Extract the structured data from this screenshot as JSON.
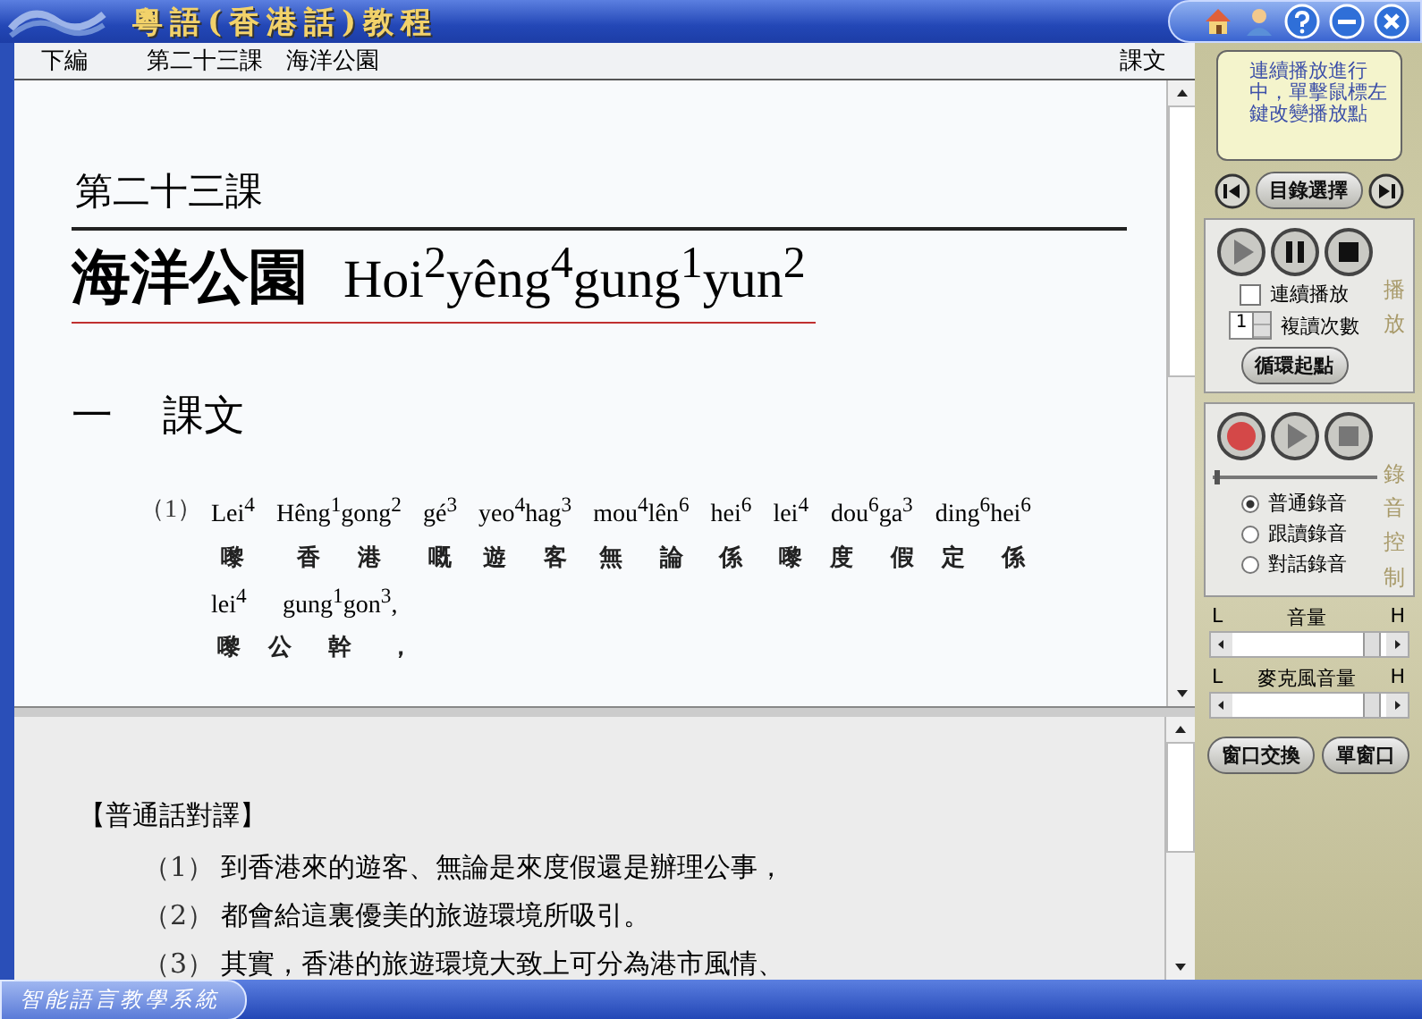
{
  "window": {
    "title": "粵語(香港話)教程"
  },
  "header": {
    "volume": "下編",
    "lesson": "第二十三課　海洋公園",
    "section": "課文"
  },
  "lesson": {
    "number": "第二十三課",
    "title": "海洋公園",
    "title_roman": "Hoi$^{2}$yêng$^{4}$gung$^{1}$yun$^{2}$",
    "heading_num": "一",
    "heading": "課文",
    "sentences": [
      {
        "num": "（1）",
        "lines": [
          [
            {
              "roman": "Lei$^{4}$",
              "hanzi": "嚟"
            },
            {
              "roman": "Hêng$^{1}$gong$^{2}$",
              "hanzi": "香港"
            },
            {
              "roman": "gé$^{3}$",
              "hanzi": "嘅"
            },
            {
              "roman": "yeo$^{4}$hag$^{3}$",
              "hanzi": "遊客"
            },
            {
              "roman": "mou$^{4}$lên$^{6}$",
              "hanzi": "無論"
            },
            {
              "roman": "hei$^{6}$",
              "hanzi": "係"
            },
            {
              "roman": "lei$^{4}$",
              "hanzi": "嚟"
            },
            {
              "roman": "dou$^{6}$ga$^{3}$",
              "hanzi": "度假"
            },
            {
              "roman": "ding$^{6}$hei$^{6}$",
              "hanzi": "定係"
            }
          ],
          [
            {
              "roman": "lei$^{4}$",
              "hanzi": "嚟"
            },
            {
              "roman": "gung$^{1}$gon$^{3}$,",
              "hanzi": "公幹，"
            }
          ]
        ]
      }
    ]
  },
  "translation": {
    "heading": "【普通話對譯】",
    "items": [
      {
        "num": "（1）",
        "text": "到香港來的遊客、無論是來度假還是辦理公事，"
      },
      {
        "num": "（2）",
        "text": "都會給這裏優美的旅遊環境所吸引。"
      },
      {
        "num": "（3）",
        "text": "其實，香港的旅遊環境大致上可分為港市風情、"
      }
    ]
  },
  "sidebar": {
    "tip": "連續播放進行中，單擊鼠標左鍵改變播放點",
    "menu_button": "目錄選擇",
    "playback": {
      "label": "播放",
      "continuous": {
        "label": "連續播放",
        "checked": false
      },
      "repeat": {
        "value": "1",
        "label": "複讀次數"
      },
      "loop_button": "循環起點"
    },
    "recording": {
      "label": "錄音控制",
      "level": 0.02,
      "modes": [
        {
          "label": "普通錄音",
          "selected": true
        },
        {
          "label": "跟讀錄音",
          "selected": false
        },
        {
          "label": "對話錄音",
          "selected": false
        }
      ]
    },
    "sliders": [
      {
        "low": "L",
        "label": "音量",
        "high": "H",
        "level": 0.95
      },
      {
        "low": "L",
        "label": "麥克風音量",
        "high": "H",
        "level": 0.95
      }
    ],
    "buttons": [
      "窗口交換",
      "單窗口"
    ]
  },
  "status_bar": {
    "system": "智能語言教學系統"
  }
}
